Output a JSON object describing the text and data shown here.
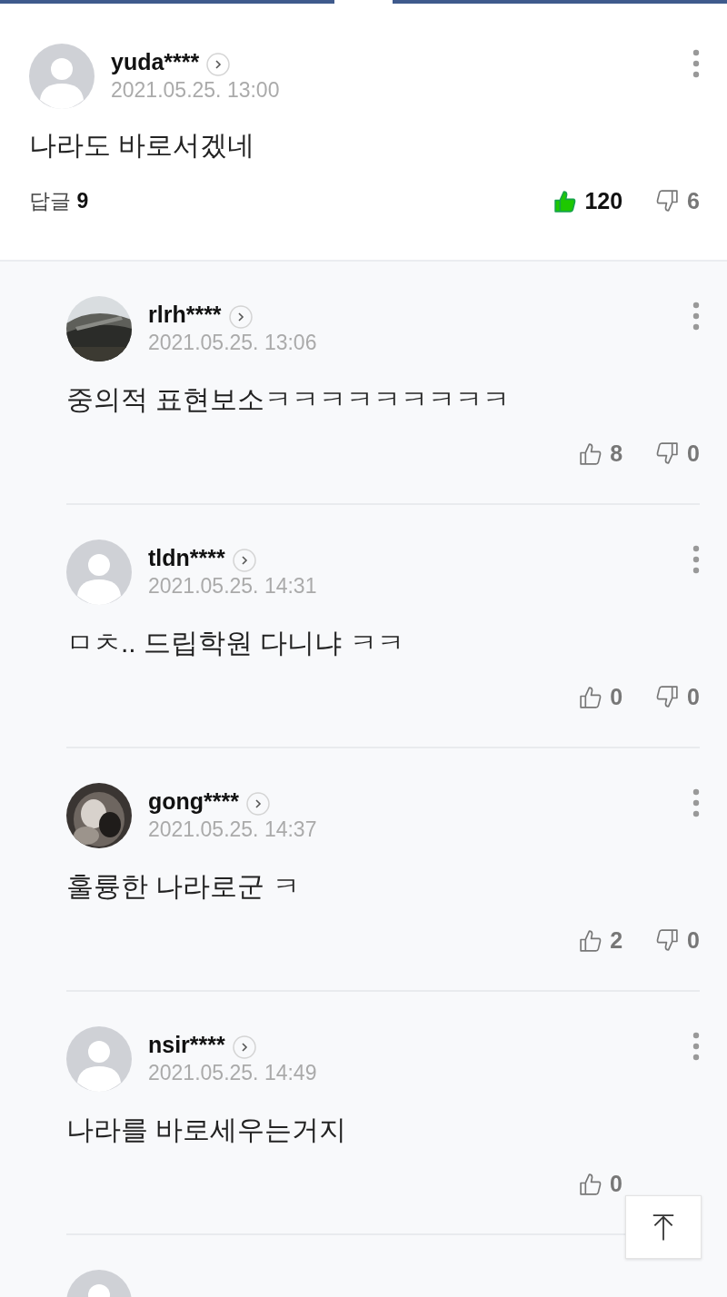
{
  "comment": {
    "author": "yuda****",
    "date": "2021.05.25. 13:00",
    "has_photo": false,
    "text": "나라도 바로서겠네",
    "replies_label": "답글",
    "replies_count": "9",
    "likes": "120",
    "dislikes": "6",
    "liked": true
  },
  "replies": [
    {
      "author": "rlrh****",
      "date": "2021.05.25. 13:06",
      "has_photo": true,
      "text": "중의적 표현보소ㅋㅋㅋㅋㅋㅋㅋㅋㅋ",
      "likes": "8",
      "dislikes": "0",
      "liked": false
    },
    {
      "author": "tldn****",
      "date": "2021.05.25. 14:31",
      "has_photo": false,
      "text": "ㅁㅊ.. 드립학원 다니냐 ㅋㅋ",
      "likes": "0",
      "dislikes": "0",
      "liked": false
    },
    {
      "author": "gong****",
      "date": "2021.05.25. 14:37",
      "has_photo": true,
      "text": "훌륭한 나라로군 ㅋ",
      "likes": "2",
      "dislikes": "0",
      "liked": false
    },
    {
      "author": "nsir****",
      "date": "2021.05.25. 14:49",
      "has_photo": false,
      "text": "나라를 바로세우는거지",
      "likes": "0",
      "liked": false
    }
  ],
  "next_reply": {
    "has_photo": false
  }
}
